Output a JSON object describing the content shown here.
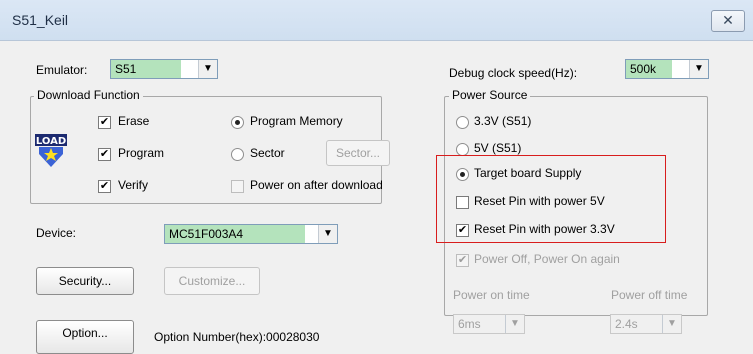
{
  "window": {
    "title": "S51_Keil",
    "close_icon": "close-icon"
  },
  "emulator": {
    "label": "Emulator:",
    "value": "S51"
  },
  "debug_clock": {
    "label": "Debug clock speed(Hz):",
    "value": "500k"
  },
  "download_function": {
    "title": "Download Function",
    "erase": {
      "label": "Erase",
      "checked": true
    },
    "program": {
      "label": "Program",
      "checked": true
    },
    "verify": {
      "label": "Verify",
      "checked": true
    },
    "program_memory": {
      "label": "Program Memory",
      "selected": true
    },
    "sector": {
      "label": "Sector",
      "selected": false
    },
    "sector_button": "Sector...",
    "power_on_after": {
      "label": "Power on after download",
      "checked": false
    },
    "icon": "load-icon",
    "icon_text": "LOAD"
  },
  "power_source": {
    "title": "Power Source",
    "opt_33": {
      "label": "3.3V (S51)",
      "selected": false
    },
    "opt_5": {
      "label": "5V (S51)",
      "selected": false
    },
    "target_board": {
      "label": "Target board Supply",
      "selected": true
    },
    "reset_5v": {
      "label": "Reset Pin with power 5V",
      "checked": false
    },
    "reset_33v": {
      "label": "Reset Pin with power 3.3V",
      "checked": true
    },
    "power_cycle": {
      "label": "Power Off, Power On again",
      "checked": true
    },
    "power_on_time": {
      "label": "Power on time",
      "value": "6ms"
    },
    "power_off_time": {
      "label": "Power off time",
      "value": "2.4s"
    },
    "highlight_color": "#d81d1d"
  },
  "device": {
    "label": "Device:",
    "value": "MC51F003A4"
  },
  "buttons": {
    "security": "Security...",
    "customize": "Customize...",
    "option": "Option..."
  },
  "option_number": "Option Number(hex):00028030"
}
